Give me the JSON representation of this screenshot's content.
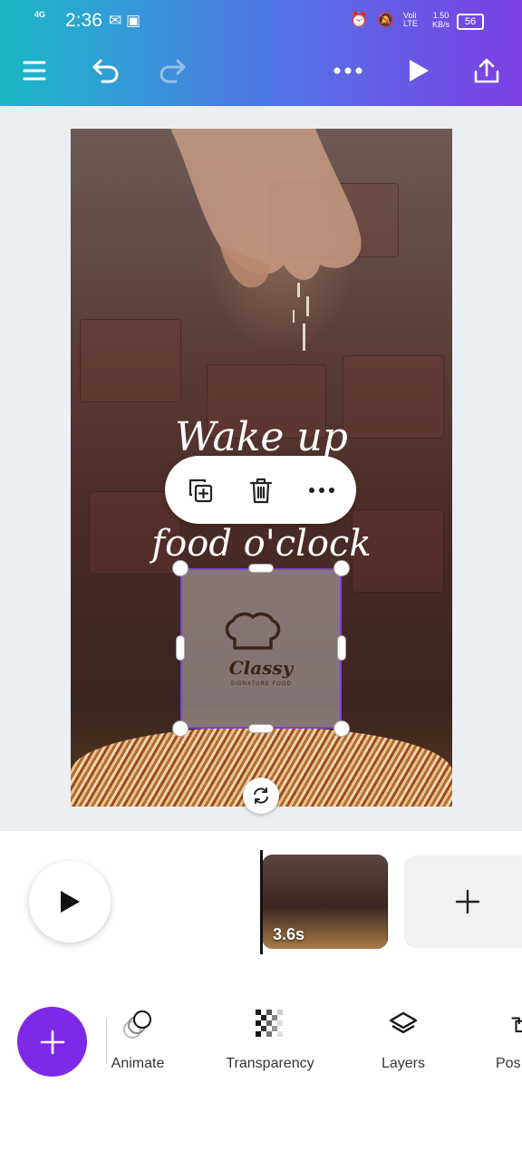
{
  "status_bar": {
    "network": "4G",
    "time": "2:36",
    "volte": "Voli LTE",
    "speed_value": "1.50",
    "speed_unit": "KB/s",
    "battery": "56"
  },
  "toolbar": {
    "menu_icon": "menu-icon",
    "undo_icon": "undo-icon",
    "redo_icon": "redo-icon",
    "more_icon": "more-icon",
    "play_icon": "play-icon",
    "share_icon": "share-icon"
  },
  "design": {
    "line1": "Wake up",
    "line2": "food o'clock",
    "logo_text": "Classy",
    "logo_subtext": "SIGNATURE FOOD"
  },
  "context_menu": {
    "duplicate_icon": "duplicate-icon",
    "delete_icon": "trash-icon",
    "more_icon": "more-icon"
  },
  "timeline": {
    "clip_duration": "3.6s",
    "add_page_icon": "plus-icon"
  },
  "bottom_toolbar": {
    "items": [
      {
        "label": "Animate",
        "icon": "animate-icon"
      },
      {
        "label": "Transparency",
        "icon": "transparency-icon"
      },
      {
        "label": "Layers",
        "icon": "layers-icon"
      },
      {
        "label": "Pos",
        "icon": "position-icon"
      }
    ]
  },
  "colors": {
    "accent": "#7d2ae8",
    "selection": "#7b3fe4",
    "header_start": "#1ab9c8",
    "header_end": "#7b3fe4"
  }
}
